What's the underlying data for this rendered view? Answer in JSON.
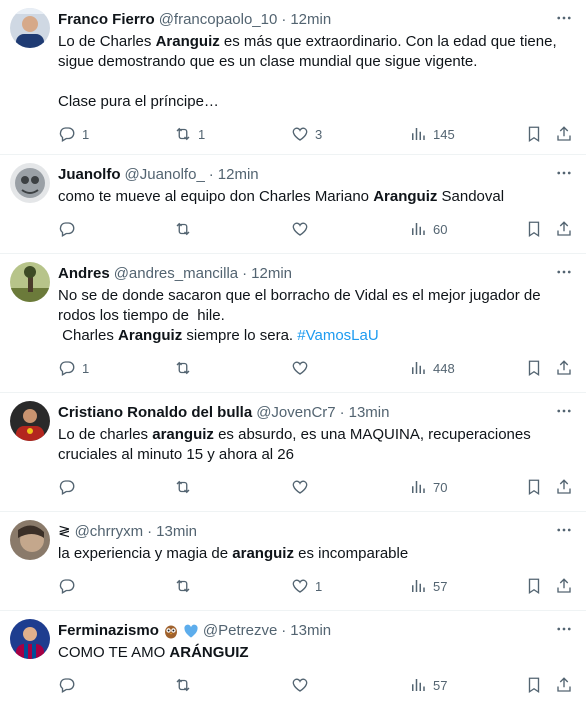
{
  "tweets": [
    {
      "name": "Franco Fierro",
      "handle": "@francopaolo_10",
      "time": "12min",
      "avatar_color": "#1f3b73",
      "lines": [
        [
          {
            "t": "Lo de Charles "
          },
          {
            "t": "Aranguiz",
            "b": true
          },
          {
            "t": " es más que extraordinario. Con la edad que tiene,"
          }
        ],
        [
          {
            "t": "sigue demostrando que es un clase mundial que sigue vigente."
          }
        ],
        [
          {
            "t": " "
          }
        ],
        [
          {
            "t": "Clase pura el príncipe…"
          }
        ]
      ],
      "replies": "1",
      "retweets": "1",
      "likes": "3",
      "views": "145"
    },
    {
      "name": "Juanolfo",
      "handle": "@Juanolfo_",
      "time": "12min",
      "avatar_color": "#9aa0a6",
      "lines": [
        [
          {
            "t": "como te mueve al equipo don Charles Mariano "
          },
          {
            "t": "Aranguiz",
            "b": true
          },
          {
            "t": " Sandoval"
          }
        ]
      ],
      "replies": "",
      "retweets": "",
      "likes": "",
      "views": "60"
    },
    {
      "name": "Andres",
      "handle": "@andres_mancilla",
      "time": "12min",
      "avatar_color": "#6b7a3a",
      "lines": [
        [
          {
            "t": "No se de donde sacaron que el borracho de Vidal es el mejor jugador de"
          }
        ],
        [
          {
            "t": "rodos los tiempo de  hile."
          }
        ],
        [
          {
            "t": " Charles "
          },
          {
            "t": "Aranguiz",
            "b": true
          },
          {
            "t": " siempre lo sera. "
          },
          {
            "t": "#VamosLaU",
            "tag": true
          }
        ]
      ],
      "replies": "1",
      "retweets": "",
      "likes": "",
      "views": "448"
    },
    {
      "name": "Cristiano Ronaldo del bulla",
      "handle": "@JovenCr7",
      "time": "13min",
      "avatar_color": "#b3261e",
      "lines": [
        [
          {
            "t": "Lo de charles "
          },
          {
            "t": "aranguiz",
            "b": true
          },
          {
            "t": " es absurdo, es una MAQUINA, recuperaciones"
          }
        ],
        [
          {
            "t": "cruciales al minuto 15 y ahora al 26"
          }
        ]
      ],
      "replies": "",
      "retweets": "",
      "likes": "",
      "views": "70"
    },
    {
      "name": "≷",
      "handle": "@chrryxm",
      "time": "13min",
      "avatar_color": "#8a7a6a",
      "lines": [
        [
          {
            "t": "la experiencia y magia de "
          },
          {
            "t": "aranguiz",
            "b": true
          },
          {
            "t": " es incomparable"
          }
        ]
      ],
      "replies": "",
      "retweets": "",
      "likes": "1",
      "views": "57"
    },
    {
      "name": "Ferminazismo",
      "emojis": [
        "owl",
        "blue-heart"
      ],
      "handle": "@Petrezve",
      "time": "13min",
      "avatar_color": "#2b4aa0",
      "lines": [
        [
          {
            "t": "COMO TE AMO "
          },
          {
            "t": "ARÁNGUIZ",
            "b": true
          }
        ]
      ],
      "replies": "",
      "retweets": "",
      "likes": "",
      "views": "57"
    }
  ],
  "colors": {
    "text": "#0f1419",
    "muted": "#536471",
    "link": "#1d9bf0",
    "border": "#eff3f4"
  },
  "icons": [
    "reply-icon",
    "retweet-icon",
    "like-icon",
    "views-icon",
    "bookmark-icon",
    "share-icon",
    "more-icon"
  ]
}
